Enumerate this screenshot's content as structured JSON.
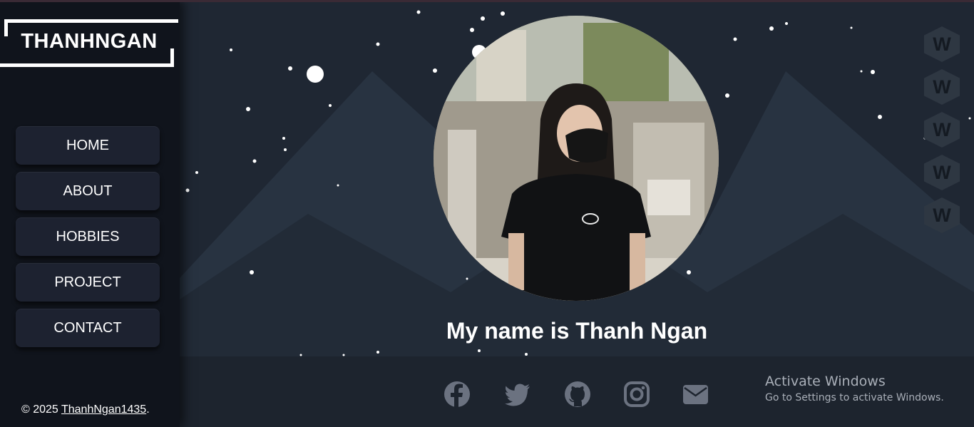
{
  "brand": {
    "logo": "THANHNGAN"
  },
  "nav": [
    {
      "label": "HOME"
    },
    {
      "label": "ABOUT"
    },
    {
      "label": "HOBBIES"
    },
    {
      "label": "PROJECT"
    },
    {
      "label": "CONTACT"
    }
  ],
  "footer_left": {
    "prefix": "© 2025 ",
    "link": "ThanhNgan1435",
    "suffix": "."
  },
  "hero": {
    "headline": "My name is Thanh Ngan"
  },
  "side_badges": [
    "W",
    "W",
    "W",
    "W",
    "W"
  ],
  "social": [
    "facebook-icon",
    "twitter-icon",
    "github-icon",
    "instagram-icon",
    "mail-icon"
  ],
  "windows_notice": {
    "title": "Activate Windows",
    "subtitle": "Go to Settings to activate Windows."
  },
  "colors": {
    "sidebar": "#10141c",
    "main": "#1f2733",
    "mountain": "#283341",
    "footer": "#1d242e",
    "icon": "#6b7280"
  }
}
